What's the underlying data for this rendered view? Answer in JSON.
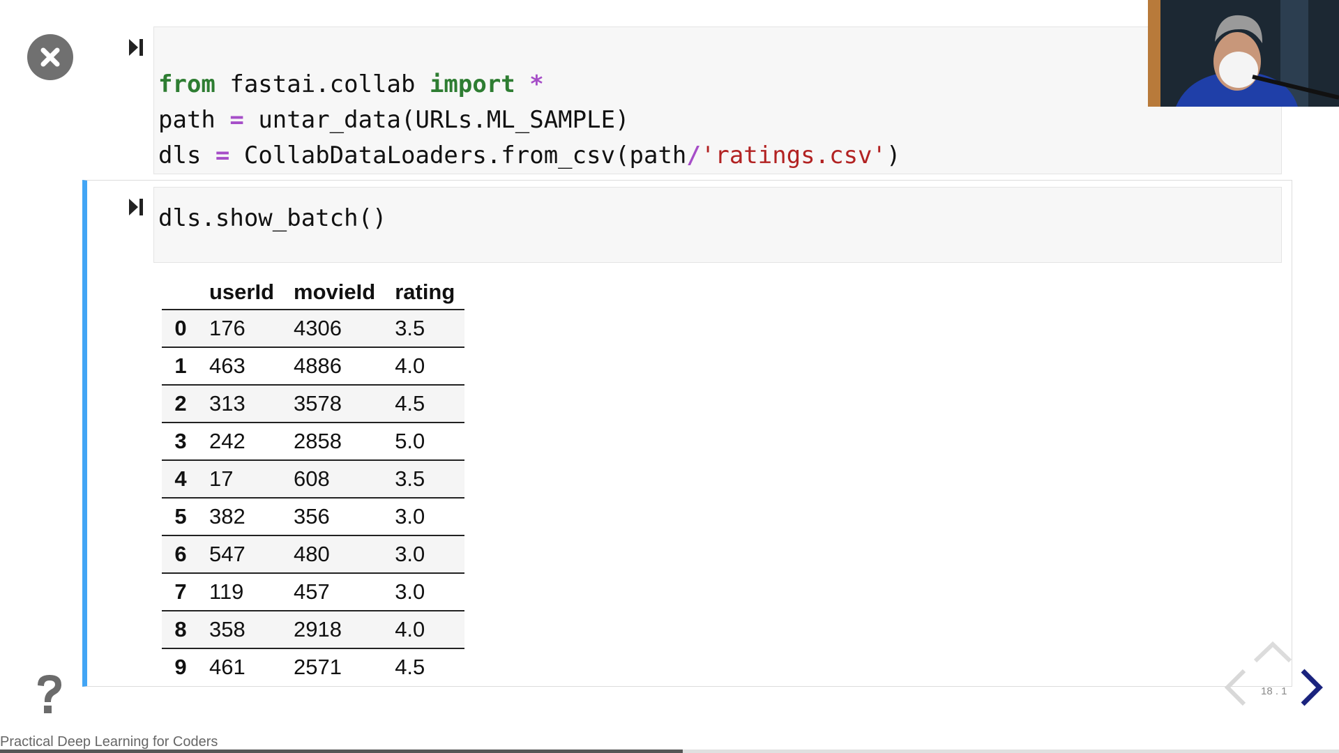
{
  "cells": [
    {
      "lines": [
        [
          {
            "t": "from",
            "c": "kw"
          },
          {
            "t": " fastai.collab "
          },
          {
            "t": "import",
            "c": "kw"
          },
          {
            "t": " "
          },
          {
            "t": "*",
            "c": "op"
          }
        ],
        [
          {
            "t": "path "
          },
          {
            "t": "=",
            "c": "op"
          },
          {
            "t": " untar_data(URLs.ML_SAMPLE)"
          }
        ],
        [
          {
            "t": "dls "
          },
          {
            "t": "=",
            "c": "op"
          },
          {
            "t": " CollabDataLoaders.from_csv(path"
          },
          {
            "t": "/",
            "c": "op"
          },
          {
            "t": "'ratings.csv'",
            "c": "str"
          },
          {
            "t": ")"
          }
        ]
      ]
    },
    {
      "lines": [
        [
          {
            "t": "dls.show_batch()"
          }
        ]
      ]
    }
  ],
  "output_table": {
    "columns": [
      "userId",
      "movieId",
      "rating"
    ],
    "rows": [
      {
        "index": "0",
        "values": [
          "176",
          "4306",
          "3.5"
        ]
      },
      {
        "index": "1",
        "values": [
          "463",
          "4886",
          "4.0"
        ]
      },
      {
        "index": "2",
        "values": [
          "313",
          "3578",
          "4.5"
        ]
      },
      {
        "index": "3",
        "values": [
          "242",
          "2858",
          "5.0"
        ]
      },
      {
        "index": "4",
        "values": [
          "17",
          "608",
          "3.5"
        ]
      },
      {
        "index": "5",
        "values": [
          "382",
          "356",
          "3.0"
        ]
      },
      {
        "index": "6",
        "values": [
          "547",
          "480",
          "3.0"
        ]
      },
      {
        "index": "7",
        "values": [
          "119",
          "457",
          "3.0"
        ]
      },
      {
        "index": "8",
        "values": [
          "358",
          "2918",
          "4.0"
        ]
      },
      {
        "index": "9",
        "values": [
          "461",
          "2571",
          "4.5"
        ]
      }
    ]
  },
  "footer": {
    "title": "Practical Deep Learning for Coders",
    "slide_number": "18 . 1",
    "progress": 0.51
  },
  "icons": {
    "close": "close-icon",
    "run": "run-cell-icon",
    "help": "help-icon",
    "nav_left": "chevron-left-icon",
    "nav_right": "chevron-right-icon",
    "nav_up": "chevron-up-icon"
  },
  "colors": {
    "keyword": "#2e7d32",
    "operator": "#a64ec8",
    "string": "#b22222",
    "selected_cell_border": "#42a5f5",
    "nav_active": "#1a237e"
  }
}
